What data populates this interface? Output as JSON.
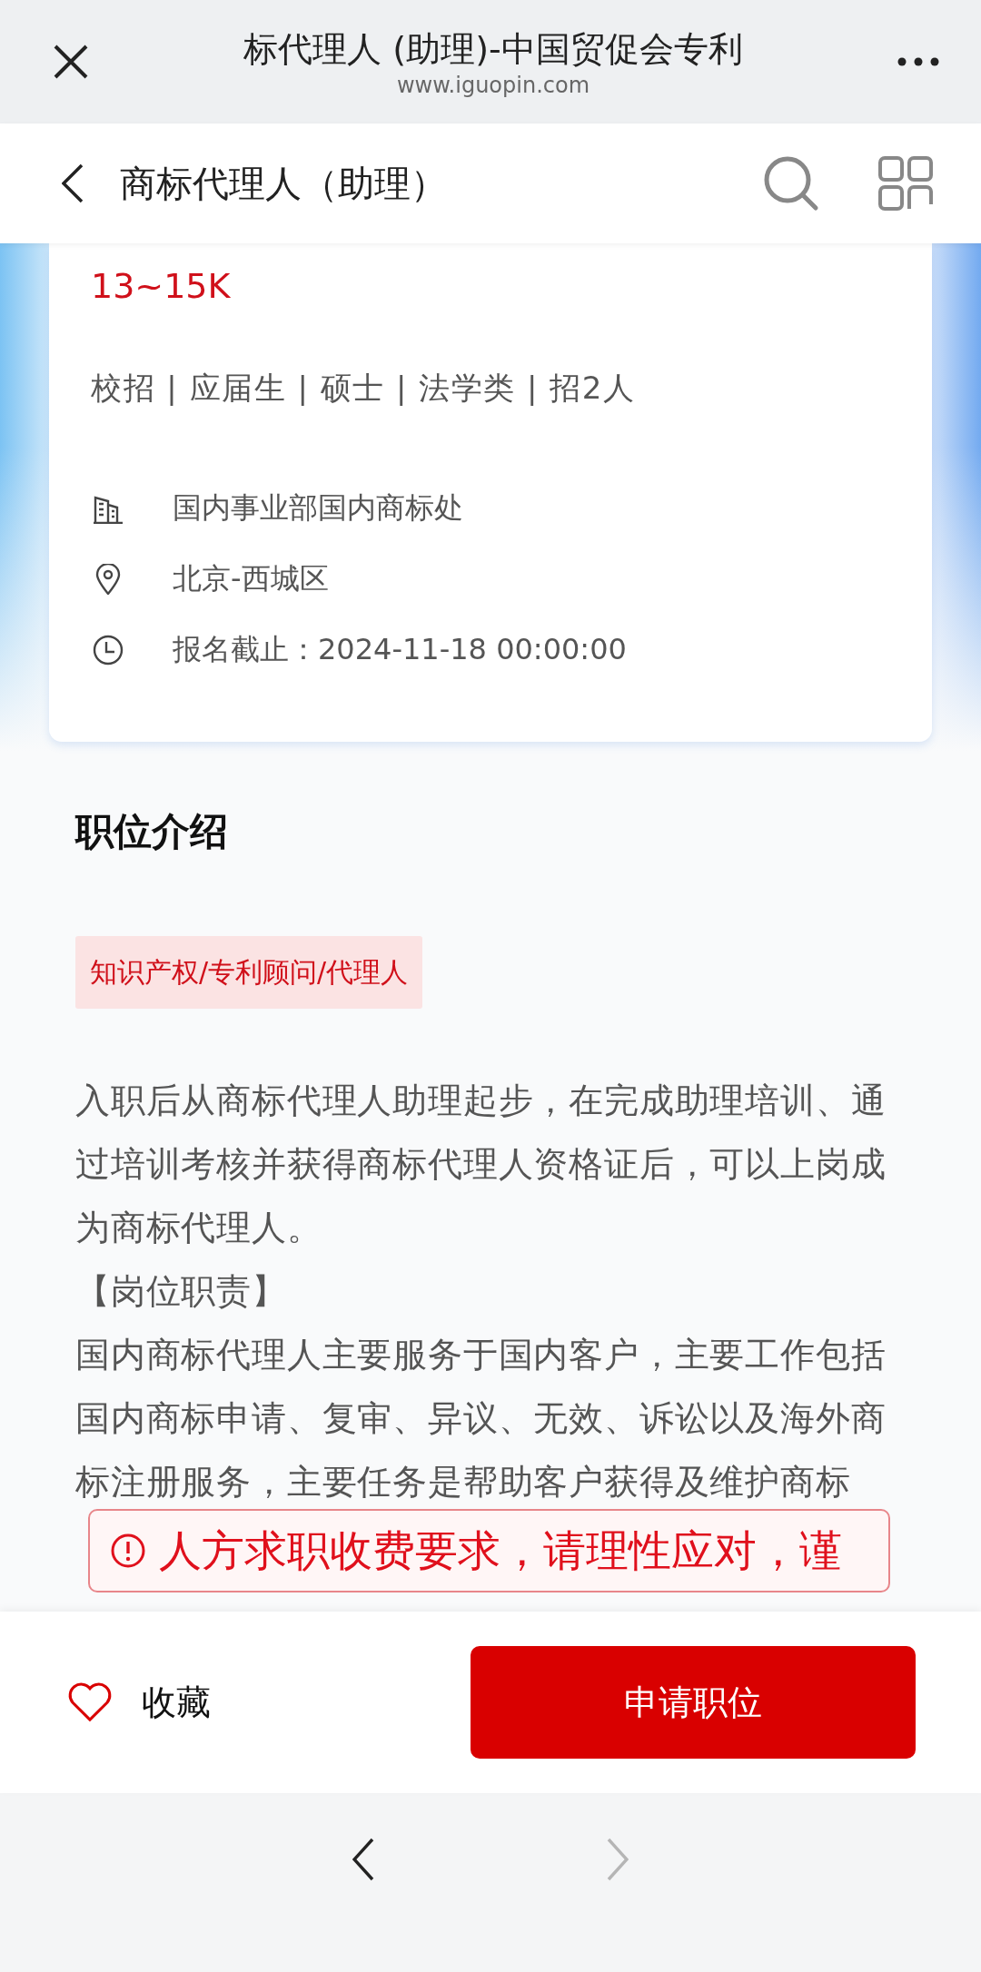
{
  "browser": {
    "title": "标代理人 (助理)-中国贸促会专利",
    "url": "www.iguopin.com"
  },
  "header": {
    "title": "商标代理人（助理）"
  },
  "job": {
    "salary": "13~15K",
    "tags": "校招 | 应届生 | 硕士 | 法学类 | 招2人",
    "info": [
      {
        "kind": "department",
        "text": "国内事业部国内商标处"
      },
      {
        "kind": "location",
        "text": "北京-西城区"
      },
      {
        "kind": "deadline",
        "text": "报名截止：2024-11-18 00:00:00"
      }
    ]
  },
  "intro": {
    "title": "职位介绍",
    "category": "知识产权/专利顾问/代理人",
    "paragraphs": [
      "入职后从商标代理人助理起步，在完成助理培训、通过培训考核并获得商标代理人资格证后，可以上岗成为商标代理人。",
      "【岗位职责】",
      "国内商标代理人主要服务于国内客户，主要工作包括国内商标申请、复审、异议、无效、诉讼以及海外商标注册服务，主要任务是帮助客户获得及维护商标"
    ]
  },
  "notice": {
    "text": "人方求职收费要求，请理性应对，谨"
  },
  "bottom_bar": {
    "favorite": {
      "label": "收藏",
      "checked": false
    },
    "apply": {
      "label": "申请职位"
    }
  },
  "nav": [
    {
      "kind": "back",
      "disabled": false
    },
    {
      "kind": "forward",
      "disabled": true
    }
  ]
}
